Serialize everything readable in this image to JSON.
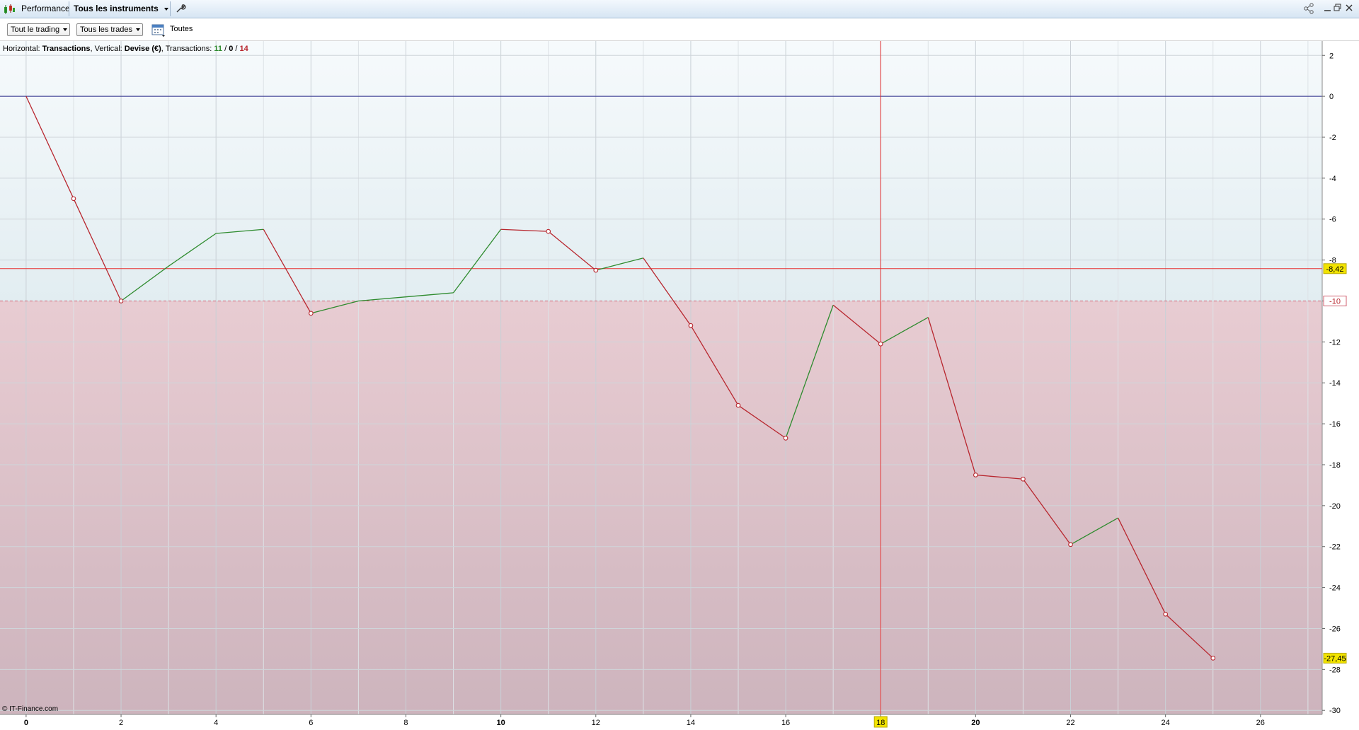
{
  "window": {
    "tab_label": "Performance",
    "instrument_selector": "Tous les instruments"
  },
  "toolbar": {
    "trading_filter": "Tout le trading",
    "trades_filter": "Tous les trades",
    "period_label": "Toutes"
  },
  "info": {
    "horizontal_prefix": "Horizontal: ",
    "horizontal_value": "Transactions",
    "vertical_prefix": ", Vertical: ",
    "vertical_value": "Devise (€)",
    "transactions_prefix": ", Transactions: ",
    "wins": "11",
    "sep": " / ",
    "neutral": "0",
    "losses": "14"
  },
  "copyright": "© IT-Finance.com",
  "colors": {
    "win_line": "#2e8b2e",
    "loss_line": "#b8262e",
    "zero_line": "#2a2a8a",
    "cursor_line": "#e83030",
    "highlight_badge": "#f2e400"
  },
  "chart_data": {
    "type": "line",
    "x_ticks": [
      "0",
      "2",
      "4",
      "6",
      "8",
      "10",
      "12",
      "14",
      "16",
      "18",
      "20",
      "22",
      "24",
      "26"
    ],
    "y_ticks": [
      "2",
      "0",
      "-2",
      "-4",
      "-6",
      "-8",
      "-10",
      "-12",
      "-14",
      "-16",
      "-18",
      "-20",
      "-22",
      "-24",
      "-26",
      "-28",
      "-30"
    ],
    "xlim": [
      -0.55,
      27.3
    ],
    "ylim": [
      -30.2,
      2.7
    ],
    "series": [
      {
        "x": [
          0,
          1,
          2,
          3,
          4,
          5,
          6,
          7,
          8,
          9,
          10,
          11,
          12,
          13,
          14,
          15,
          16,
          17,
          18,
          19,
          20,
          21,
          22,
          23,
          24,
          25
        ],
        "values": [
          0,
          -5.0,
          -10.0,
          -8.3,
          -6.7,
          -6.5,
          -10.6,
          -10.0,
          -9.8,
          -9.6,
          -6.5,
          -6.6,
          -8.5,
          -7.9,
          -11.2,
          -15.1,
          -16.7,
          -10.2,
          -12.1,
          -10.8,
          -18.5,
          -18.7,
          -21.9,
          -20.6,
          -25.3,
          -27.45
        ]
      }
    ],
    "current_value_label": "-8,42",
    "current_value": -8.42,
    "threshold_label": "-10",
    "threshold_value": -10,
    "last_value_label": "-27,45",
    "last_value": -27.45,
    "cursor_x": 18,
    "cursor_label": "18",
    "bold_x_ticks": [
      "0",
      "10",
      "20"
    ],
    "grid": true
  }
}
